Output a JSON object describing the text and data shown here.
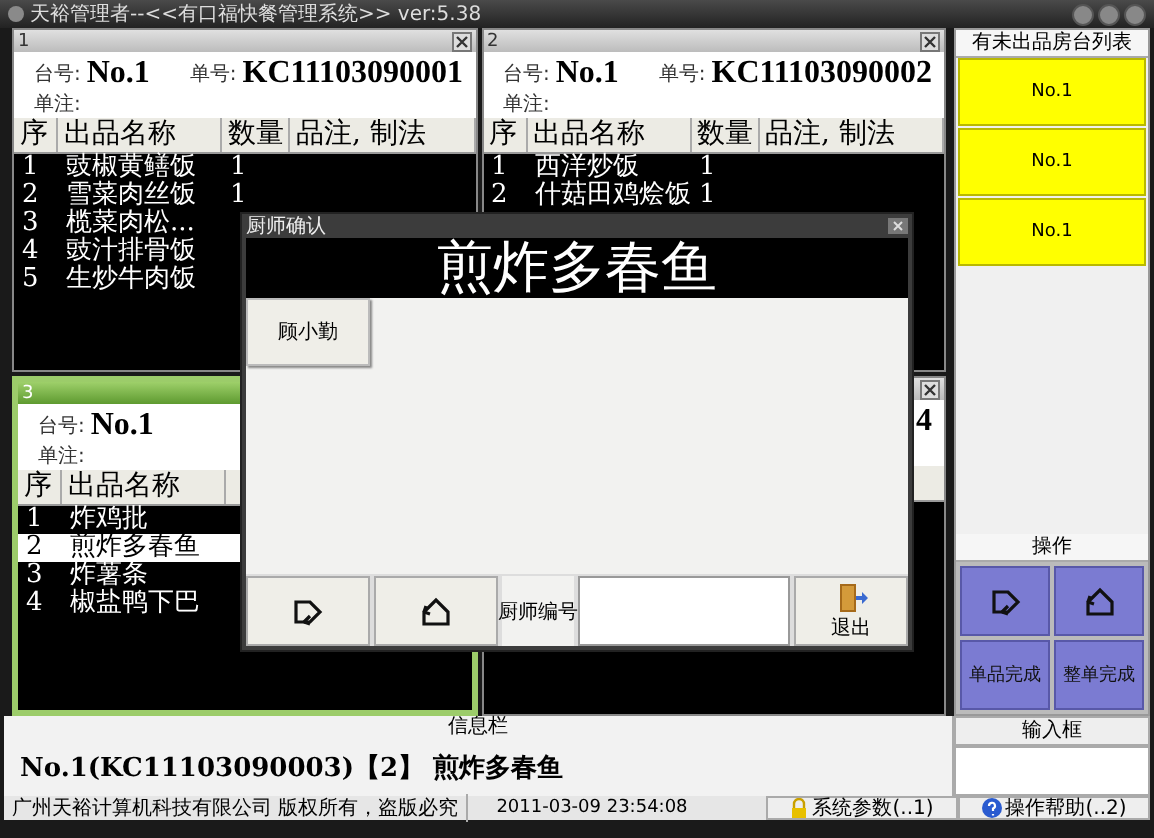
{
  "window": {
    "title": "天裕管理者--<<有口福快餐管理系统>> ver:5.38"
  },
  "orders": [
    {
      "number": "1",
      "active": false,
      "table_label": "台号:",
      "table_no": "No.1",
      "order_label": "单号:",
      "order_no": "KC11103090001",
      "note_label": "单注:",
      "columns": [
        "序",
        "出品名称",
        "数量",
        "品注, 制法"
      ],
      "rows": [
        {
          "seq": "1",
          "name": "豉椒黄鳝饭",
          "qty": "1",
          "selected": false
        },
        {
          "seq": "2",
          "name": "雪菜肉丝饭",
          "qty": "1",
          "selected": false
        },
        {
          "seq": "3",
          "name": "榄菜肉松...",
          "selected": false
        },
        {
          "seq": "4",
          "name": "豉汁排骨饭",
          "selected": false
        },
        {
          "seq": "5",
          "name": "生炒牛肉饭",
          "selected": false
        }
      ]
    },
    {
      "number": "2",
      "active": false,
      "table_label": "台号:",
      "table_no": "No.1",
      "order_label": "单号:",
      "order_no": "KC11103090002",
      "note_label": "单注:",
      "columns": [
        "序",
        "出品名称",
        "数量",
        "品注, 制法"
      ],
      "rows": [
        {
          "seq": "1",
          "name": "西洋炒饭",
          "qty": "1",
          "selected": false
        },
        {
          "seq": "2",
          "name": "什菇田鸡烩饭",
          "qty": "1",
          "selected": false
        }
      ]
    },
    {
      "number": "3",
      "active": true,
      "table_label": "台号:",
      "table_no": "No.1",
      "note_label": "单注:",
      "columns": [
        "序",
        "出品名称"
      ],
      "rows": [
        {
          "seq": "1",
          "name": "炸鸡批",
          "selected": false
        },
        {
          "seq": "2",
          "name": "煎炸多春鱼",
          "selected": true
        },
        {
          "seq": "3",
          "name": "炸薯条",
          "selected": false
        },
        {
          "seq": "4",
          "name": "椒盐鸭下巴",
          "selected": false
        }
      ]
    },
    {
      "active": false,
      "order_no": "4"
    }
  ],
  "pending_tables": {
    "title": "有未出品房台列表",
    "items": [
      {
        "label": "No.1"
      },
      {
        "label": "No.1"
      },
      {
        "label": "No.1"
      }
    ]
  },
  "operations": {
    "title": "操作",
    "buttons": [
      {
        "kind": "prev"
      },
      {
        "kind": "next"
      },
      {
        "kind": "text",
        "label": "单品完成"
      },
      {
        "kind": "text",
        "label": "整单完成"
      }
    ]
  },
  "info": {
    "title": "信息栏",
    "message": "No.1(KC11103090003)【2】 煎炸多春鱼",
    "input_title": "输入框"
  },
  "status_bar": {
    "company": "广州天裕计算机科技有限公司 版权所有，盗版必究",
    "datetime": "2011-03-09 23:54:08",
    "settings": "系统参数(..1)",
    "help": "操作帮助(..2)"
  },
  "dialog": {
    "title": "厨师确认",
    "dish": "煎炸多春鱼",
    "chefs": [
      {
        "name": "顾小勤"
      }
    ],
    "nav": [
      {
        "kind": "prev"
      },
      {
        "kind": "next"
      }
    ],
    "chef_no_label": "厨师编号",
    "exit_label": "退出"
  }
}
